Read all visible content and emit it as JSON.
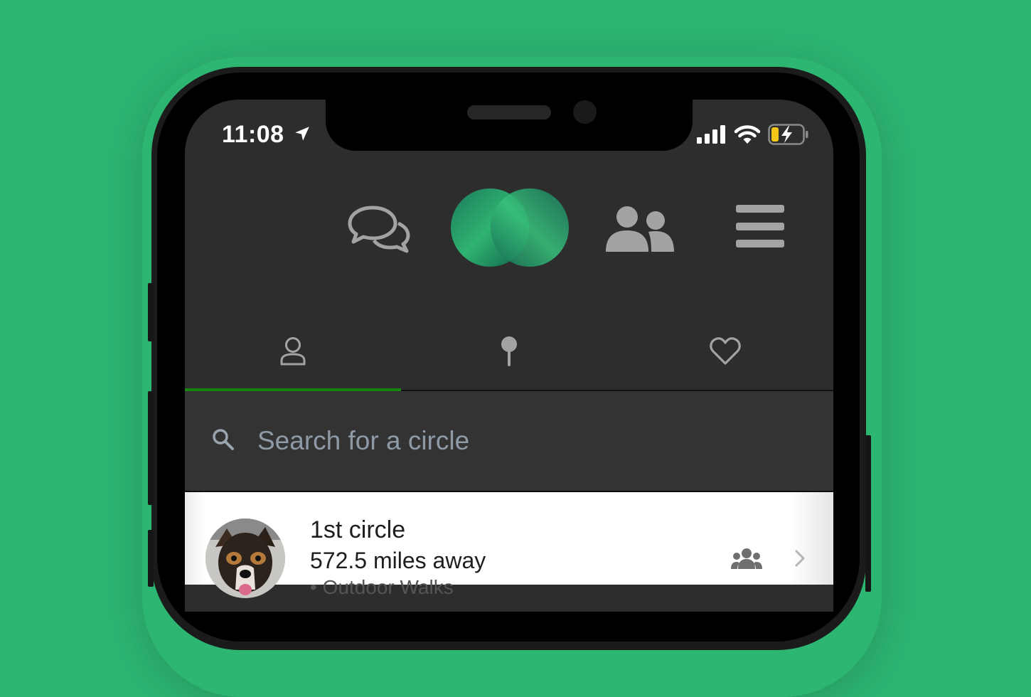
{
  "status_bar": {
    "time": "11:08",
    "icons": [
      "location-arrow-icon",
      "signal-icon",
      "wifi-icon",
      "battery-charging-icon"
    ],
    "battery_color": "#f5c518"
  },
  "header": {
    "icons": [
      "chat-bubbles-icon",
      "app-logo",
      "people-icon",
      "hamburger-menu-icon"
    ]
  },
  "tabs": [
    {
      "icon": "person-icon",
      "active": true
    },
    {
      "icon": "pin-icon",
      "active": false
    },
    {
      "icon": "heart-icon",
      "active": false
    }
  ],
  "search": {
    "placeholder": "Search for a circle",
    "value": ""
  },
  "circles": [
    {
      "title": "1st circle",
      "distance": "572.5 miles away",
      "extra": "• Outdoor Walks",
      "icons": [
        "group-icon",
        "chevron-right-icon"
      ]
    }
  ],
  "colors": {
    "background": "#2db572",
    "screen": "#2d2d2d",
    "accent": "#16850f",
    "icon": "#a3a3a3"
  }
}
